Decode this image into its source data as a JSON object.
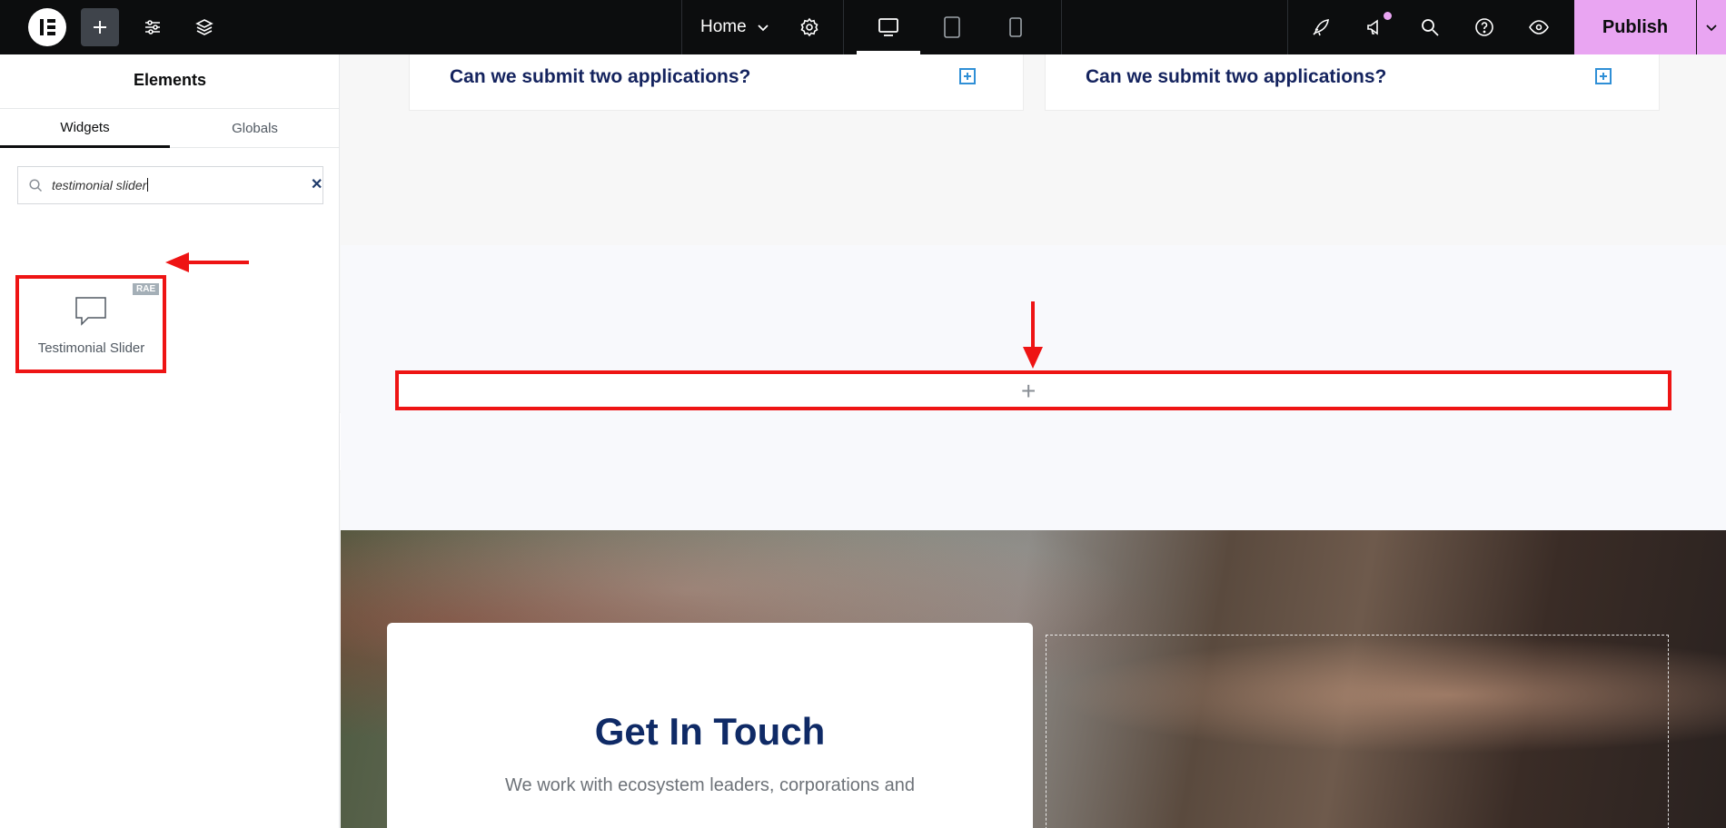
{
  "topbar": {
    "page_name": "Home",
    "publish_label": "Publish",
    "colors": {
      "background": "#0c0d0e",
      "publish": "#e9a5f2"
    },
    "icons": [
      "elementor-logo-icon",
      "plus-icon",
      "sliders-icon",
      "layers-icon",
      "gear-icon",
      "desktop-icon",
      "tablet-icon",
      "mobile-icon",
      "rocket-icon",
      "megaphone-icon",
      "search-icon",
      "help-icon",
      "eye-icon",
      "chevron-down-icon"
    ]
  },
  "panel": {
    "title": "Elements",
    "tabs": [
      {
        "label": "Widgets",
        "active": true
      },
      {
        "label": "Globals",
        "active": false
      }
    ],
    "search": {
      "value": "testimonial slider"
    },
    "widgets": [
      {
        "label": "Testimonial Slider",
        "badge": "RAE",
        "icon": "speech-bubble-icon"
      }
    ]
  },
  "canvas": {
    "faq_items": [
      {
        "question": "Can we submit two applications?"
      },
      {
        "question": "Can we submit two applications?"
      }
    ],
    "contact": {
      "title": "Get In Touch",
      "text": "We work with ecosystem leaders, corporations and"
    }
  }
}
